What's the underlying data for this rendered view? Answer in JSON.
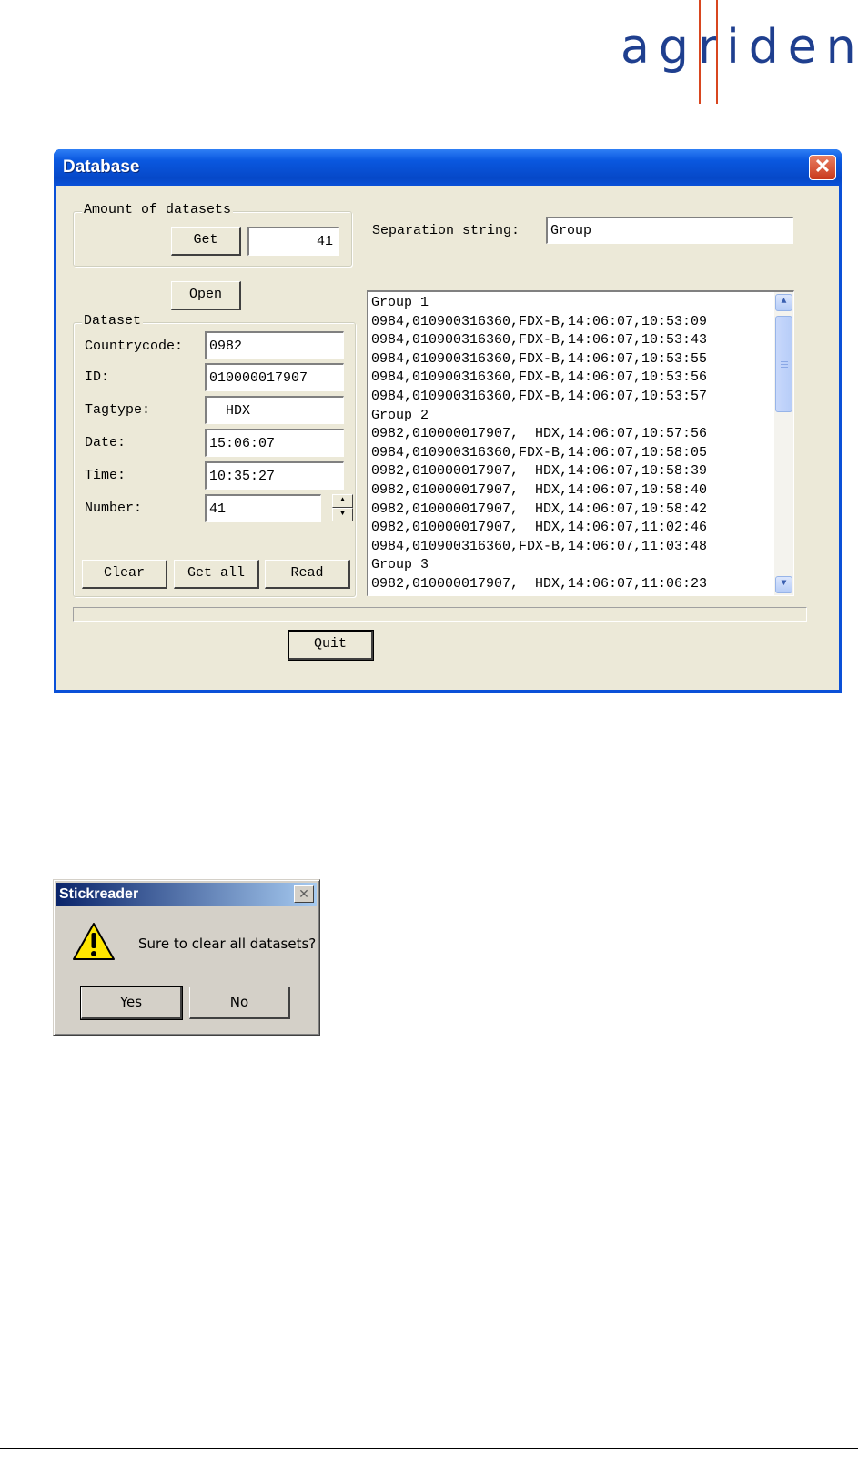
{
  "logo": {
    "text": "agrident"
  },
  "database": {
    "title": "Database",
    "amount_group": {
      "legend": "Amount of datasets",
      "get_label": "Get",
      "count_value": "41"
    },
    "separation": {
      "label": "Separation string:",
      "value": "Group"
    },
    "open_label": "Open",
    "dataset_group": {
      "legend": "Dataset",
      "countrycode_label": "Countrycode:",
      "countrycode_value": "0982",
      "id_label": "ID:",
      "id_value": "010000017907",
      "tagtype_label": "Tagtype:",
      "tagtype_value": "  HDX",
      "date_label": "Date:",
      "date_value": "15:06:07",
      "time_label": "Time:",
      "time_value": "10:35:27",
      "number_label": "Number:",
      "number_value": "41"
    },
    "buttons": {
      "clear": "Clear",
      "get_all": "Get all",
      "read": "Read",
      "quit": "Quit"
    },
    "records": [
      "Group 1",
      "0984,010900316360,FDX-B,14:06:07,10:53:09",
      "0984,010900316360,FDX-B,14:06:07,10:53:43",
      "0984,010900316360,FDX-B,14:06:07,10:53:55",
      "0984,010900316360,FDX-B,14:06:07,10:53:56",
      "0984,010900316360,FDX-B,14:06:07,10:53:57",
      "Group 2",
      "0982,010000017907,  HDX,14:06:07,10:57:56",
      "0984,010900316360,FDX-B,14:06:07,10:58:05",
      "0982,010000017907,  HDX,14:06:07,10:58:39",
      "0982,010000017907,  HDX,14:06:07,10:58:40",
      "0982,010000017907,  HDX,14:06:07,10:58:42",
      "0982,010000017907,  HDX,14:06:07,11:02:46",
      "0984,010900316360,FDX-B,14:06:07,11:03:48",
      "Group 3",
      "0982,010000017907,  HDX,14:06:07,11:06:23"
    ]
  },
  "dialog": {
    "title": "Stickreader",
    "message": "Sure to clear all datasets?",
    "yes": "Yes",
    "no": "No",
    "icon": "warning-icon"
  }
}
